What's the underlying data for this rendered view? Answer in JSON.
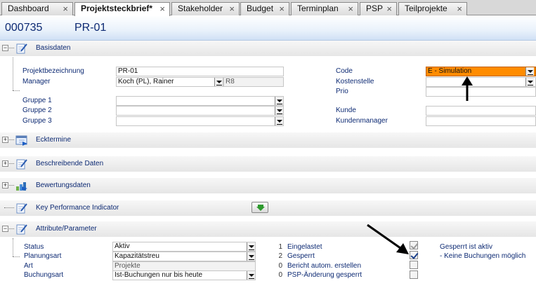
{
  "tabs": [
    {
      "label": "Dashboard",
      "active": false
    },
    {
      "label": "Projektsteckbrief*",
      "active": true
    },
    {
      "label": "Stakeholder",
      "active": false
    },
    {
      "label": "Budget",
      "active": false
    },
    {
      "label": "Terminplan",
      "active": false
    },
    {
      "label": "PSP",
      "active": false
    },
    {
      "label": "Teilprojekte",
      "active": false
    }
  ],
  "tab_close": "×",
  "header": {
    "project_id": "000735",
    "project_code": "PR-01"
  },
  "sections": {
    "basisdaten": {
      "label": "Basisdaten",
      "toggle": "−"
    },
    "ecktermine": {
      "label": "Ecktermine",
      "toggle": "+"
    },
    "beschreibende": {
      "label": "Beschreibende Daten",
      "toggle": "+"
    },
    "bewertung": {
      "label": "Bewertungsdaten",
      "toggle": "+"
    },
    "kpi": {
      "label": "Key Performance Indicator"
    },
    "attribute": {
      "label": "Attribute/Parameter",
      "toggle": "−"
    }
  },
  "basisdaten": {
    "projektbezeichnung": {
      "label": "Projektbezeichnung",
      "value": "PR-01"
    },
    "manager": {
      "label": "Manager",
      "value": "Koch (PL), Rainer",
      "suffix": "R8"
    },
    "gruppe1": {
      "label": "Gruppe 1",
      "value": ""
    },
    "gruppe2": {
      "label": "Gruppe 2",
      "value": ""
    },
    "gruppe3": {
      "label": "Gruppe 3",
      "value": ""
    },
    "code": {
      "label": "Code",
      "value": "E - Simulation"
    },
    "kostenstelle": {
      "label": "Kostenstelle",
      "value": ""
    },
    "prio": {
      "label": "Prio",
      "value": ""
    },
    "kunde": {
      "label": "Kunde",
      "value": ""
    },
    "kundenmanager": {
      "label": "Kundenmanager",
      "value": ""
    }
  },
  "attribute": {
    "status": {
      "label": "Status",
      "value": "Aktiv",
      "count": "1"
    },
    "planungsart": {
      "label": "Planungsart",
      "value": "Kapazitätstreu",
      "count": "2"
    },
    "art": {
      "label": "Art",
      "value": "Projekte",
      "count": "0"
    },
    "buchungsart": {
      "label": "Buchungsart",
      "value": "Ist-Buchungen nur bis heute",
      "count": "0"
    },
    "checkboxes": [
      {
        "label": "Eingelastet",
        "checked": true
      },
      {
        "label": "Gesperrt",
        "checked": true
      },
      {
        "label": "Bericht autom. erstellen",
        "checked": false
      },
      {
        "label": "PSP-Änderung gesperrt",
        "checked": false
      }
    ],
    "note_line1": "Gesperrt ist aktiv",
    "note_line2": "- Keine Buchungen möglich"
  },
  "colors": {
    "accent_orange": "#ff8c00",
    "label_blue": "#0d2a73"
  }
}
